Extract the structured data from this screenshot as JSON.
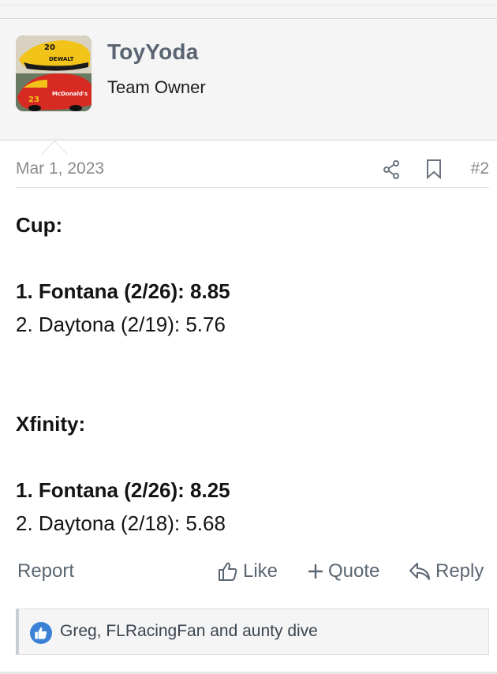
{
  "user": {
    "name": "ToyYoda",
    "title": "Team Owner",
    "avatar_alt": "race-cars-avatar"
  },
  "post": {
    "date": "Mar 1, 2023",
    "number": "#2",
    "lines": [
      {
        "text": "Cup:",
        "bold": true
      },
      {
        "text": "",
        "bold": false
      },
      {
        "text": "1. Fontana (2/26): 8.85",
        "bold": true
      },
      {
        "text": "2. Daytona (2/19): 5.76",
        "bold": false
      },
      {
        "text": "",
        "bold": false
      },
      {
        "text": "",
        "bold": false
      },
      {
        "text": "Xfinity:",
        "bold": true
      },
      {
        "text": "",
        "bold": false
      },
      {
        "text": "1. Fontana (2/26): 8.25",
        "bold": true
      },
      {
        "text": "2. Daytona (2/18): 5.68",
        "bold": false
      }
    ]
  },
  "actions": {
    "report": "Report",
    "like": "Like",
    "quote": "Quote",
    "reply": "Reply"
  },
  "reactions": {
    "text": "Greg, FLRacingFan and aunty dive"
  },
  "colors": {
    "username": "#5a6472",
    "action": "#5b6673",
    "like_badge": "#3b82d6"
  },
  "icons": [
    "share-icon",
    "bookmark-icon",
    "thumbs-up-icon",
    "plus-icon",
    "reply-arrow-icon",
    "like-reaction-icon"
  ]
}
